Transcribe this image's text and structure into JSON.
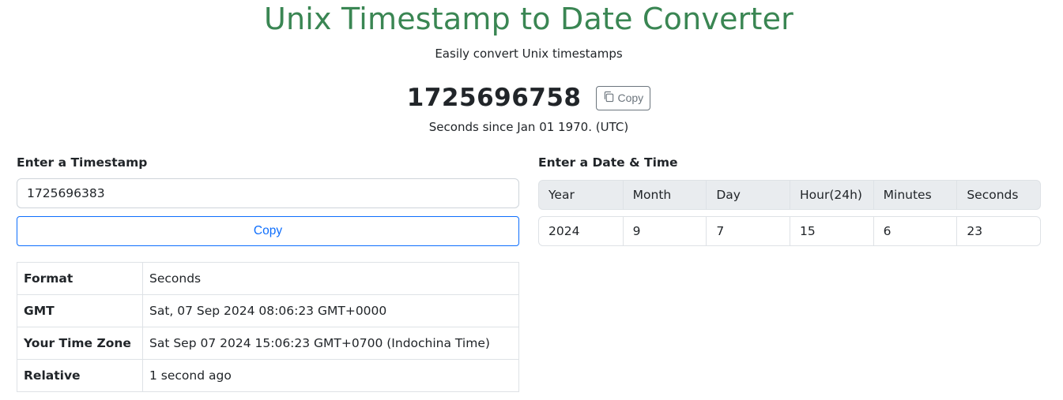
{
  "header": {
    "title": "Unix Timestamp to Date Converter",
    "subtitle": "Easily convert Unix timestamps"
  },
  "current": {
    "timestamp": "1725696758",
    "copy_label": "Copy",
    "caption": "Seconds since Jan 01 1970. (UTC)"
  },
  "timestamp_panel": {
    "label": "Enter a Timestamp",
    "input_value": "1725696383",
    "copy_label": "Copy",
    "rows": [
      {
        "key": "Format",
        "value": "Seconds"
      },
      {
        "key": "GMT",
        "value": "Sat, 07 Sep 2024 08:06:23 GMT+0000"
      },
      {
        "key": "Your Time Zone",
        "value": "Sat Sep 07 2024 15:06:23 GMT+0700 (Indochina Time)"
      },
      {
        "key": "Relative",
        "value": "1 second ago"
      }
    ]
  },
  "date_panel": {
    "label": "Enter a Date & Time",
    "headers": [
      "Year",
      "Month",
      "Day",
      "Hour(24h)",
      "Minutes",
      "Seconds"
    ],
    "values": [
      "2024",
      "9",
      "7",
      "15",
      "6",
      "23"
    ]
  },
  "colors": {
    "title": "#3a8653",
    "primary": "#0d6efd",
    "secondary": "#6c757d"
  },
  "icons": {
    "copy": "copy-icon"
  }
}
